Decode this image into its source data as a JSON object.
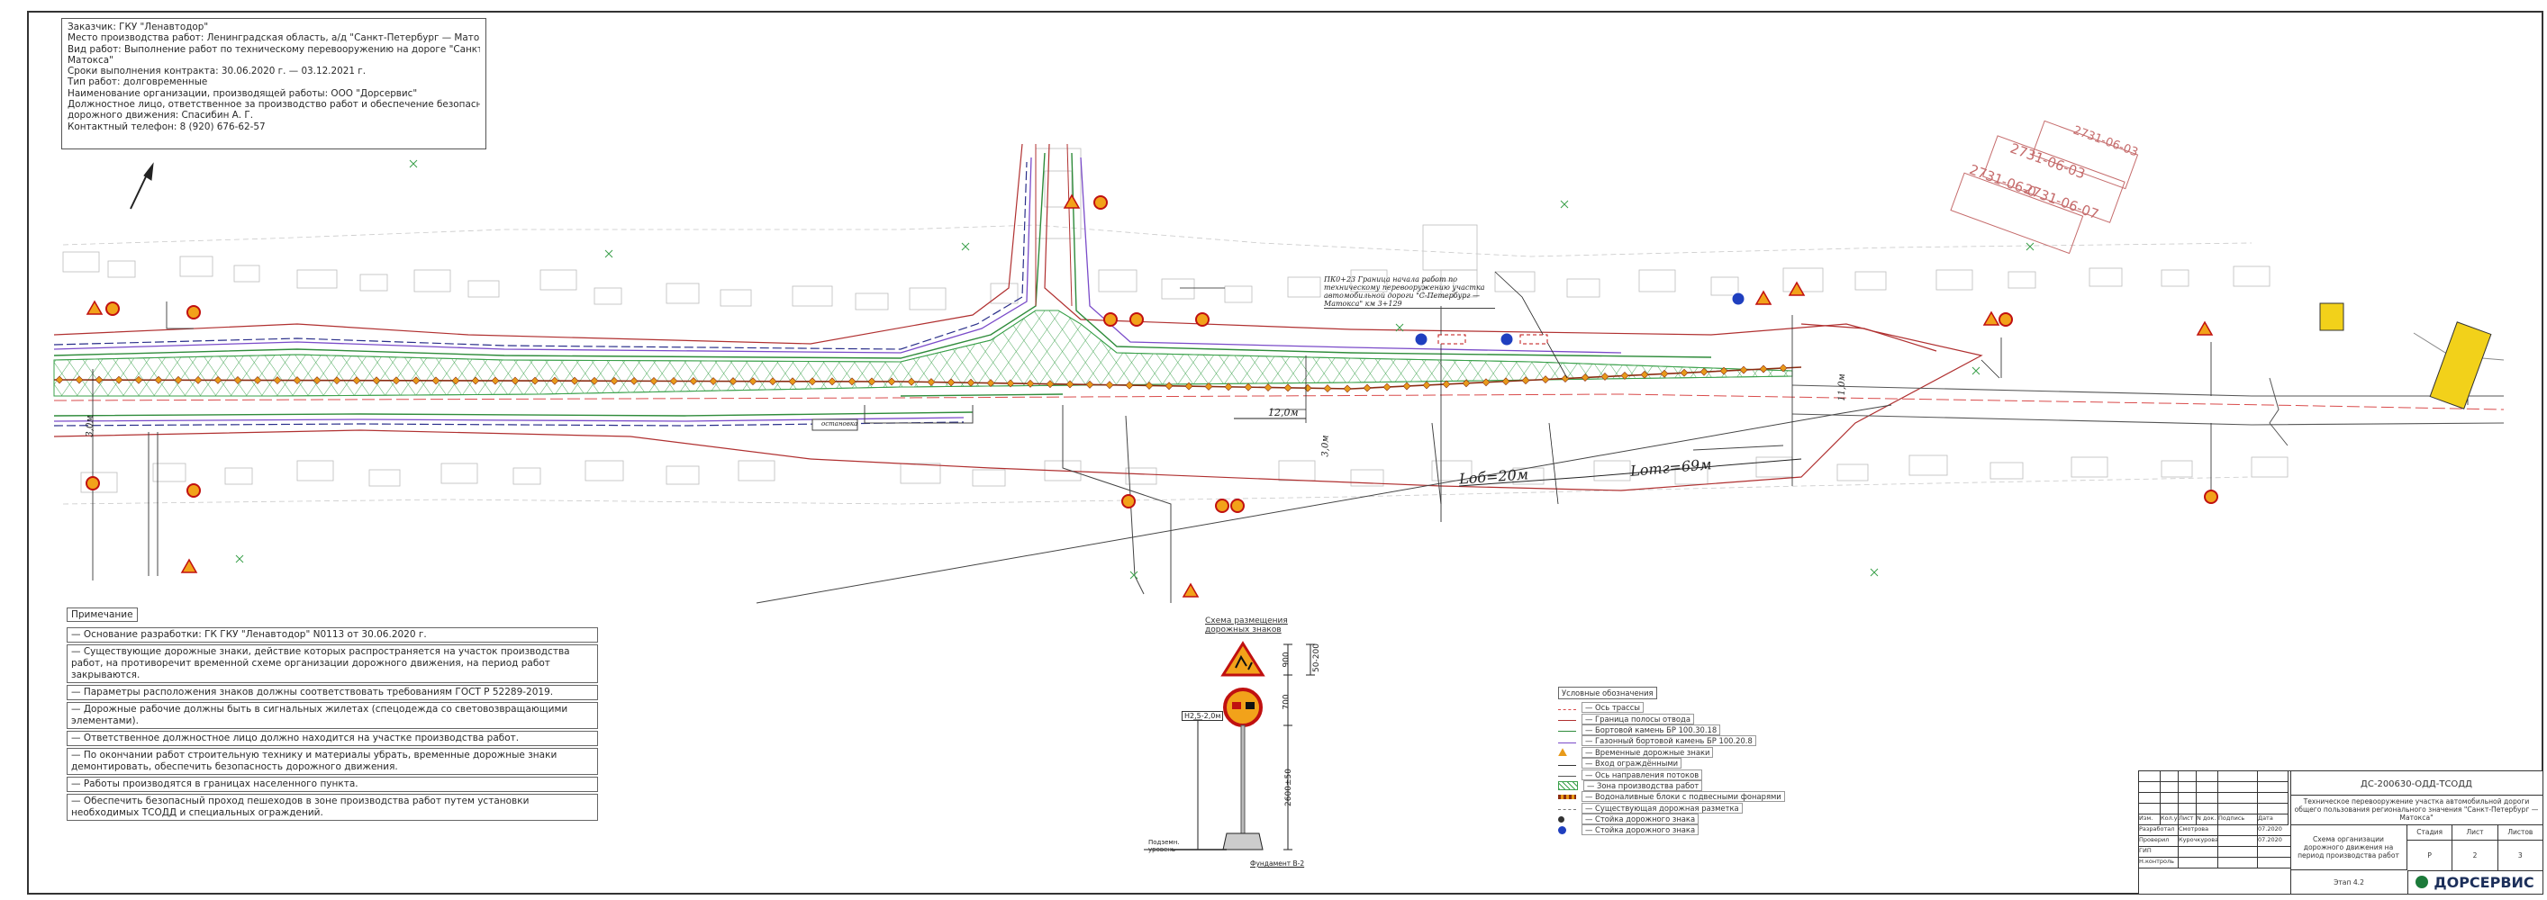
{
  "info": {
    "lines": [
      "Заказчик: ГКУ \"Ленавтодор\"",
      "Место производства работ: Ленинградская область, а/д \"Санкт-Петербург — Матокса\"",
      "Вид работ: Выполнение работ по техническому перевооружению на дороге \"Санкт-Петербург —",
      "Матокса\"",
      "Сроки выполнения контракта: 30.06.2020 г. — 03.12.2021 г.",
      "Тип работ: долговременные",
      "Наименование организации, производящей работы: ООО \"Дорсервис\"",
      "Должностное лицо, ответственное за производство работ и обеспечение безопасности",
      "дорожного движения: Спасибин А. Г.",
      "Контактный телефон: 8 (920) 676-62-57"
    ]
  },
  "notes": {
    "heading": "Примечание",
    "items": [
      "— Основание разработки: ГК ГКУ \"Ленавтодор\" N0113 от 30.06.2020 г.",
      "— Существующие дорожные знаки, действие которых распространяется на участок производства работ, на противоречит временной схеме организации дорожного движения, на период работ закрываются.",
      "— Параметры расположения знаков должны соответствовать требованиям ГОСТ Р 52289-2019.",
      "— Дорожные рабочие должны быть в сигнальных жилетах (спецодежда со световозвращающими элементами).",
      "— Ответственное должностное лицо должно находится на участке производства работ.",
      "— По окончании работ строительную технику и материалы убрать, временные дорожные знаки демонтировать, обеспечить безопасность дорожного движения.",
      "— Работы производятся в границах населенного пункта.",
      "— Обеспечить безопасный проход пешеходов в зоне производства работ путем установки необходимых ТСОДД и специальных ограждений."
    ]
  },
  "scheme": {
    "title_1": "Схема размещения",
    "title_2": "дорожных знаков",
    "dim_900": "900",
    "dim_50_200": "50-200",
    "dim_700": "700",
    "dim_2600": "2600±50",
    "label_height": "H2,5-2,0м",
    "label_ground": "Подземн. уровень",
    "label_foundation": "Фундамент В-2"
  },
  "legend": {
    "title": "Условные обозначения",
    "items": [
      {
        "label": "— Ось трассы",
        "color": "#d94b4b",
        "style": "dash"
      },
      {
        "label": "— Граница полосы отвода",
        "color": "#b03030",
        "style": "solid"
      },
      {
        "label": "— Бортовой камень БР 100.30.18",
        "color": "#2e8b3a",
        "style": "solid"
      },
      {
        "label": "— Газонный бортовой камень БР 100.20.8",
        "color": "#7a4bc9",
        "style": "solid"
      },
      {
        "label": "— Временные дорожные знаки",
        "color": "#e89a1a",
        "style": "sign"
      },
      {
        "label": "— Вход ограждёнными",
        "color": "#333333",
        "style": "solid"
      },
      {
        "label": "— Ось направления потоков",
        "color": "#555555",
        "style": "arrow"
      },
      {
        "label": "— Зона производства работ",
        "color": "#3aa04a",
        "style": "hatch"
      },
      {
        "label": "— Водоналивные блоки с подвесными фонарями",
        "color": "#8b2c12",
        "style": "blocks"
      },
      {
        "label": "— Существующая дорожная разметка",
        "color": "#777777",
        "style": "dash"
      },
      {
        "label": "— Стойка дорожного знака",
        "color": "#333333",
        "style": "dot"
      },
      {
        "label": "— Стойка дорожного знака",
        "color": "#1f3fbf",
        "style": "bluedot"
      }
    ]
  },
  "stamp": {
    "doc_number": "ДС-200630-ОДД-ТСОДД",
    "project": "Техническое перевооружение участка автомобильной дороги общего пользования регионального значения \"Санкт-Петербург — Матокса\"",
    "sheet_title": "Схема организации дорожного движения на период производства работ",
    "stage_h": "Стадия",
    "sheet_h": "Лист",
    "sheets_h": "Листов",
    "stage": "Р",
    "sheet": "2",
    "sheets": "3",
    "phase": "Этап 4.2",
    "company": "ДОРСЕРВИС",
    "roles": [
      "Изм.",
      "Кол.уч",
      "Лист",
      "N док.",
      "Подпись",
      "Дата"
    ],
    "people": [
      {
        "role": "Разработал",
        "name": "Смотрова",
        "date": "07.2020"
      },
      {
        "role": "Проверил",
        "name": "Курочкурова",
        "date": "07.2020"
      },
      {
        "role": "ГИП",
        "name": "",
        "date": ""
      },
      {
        "role": "Н.контроль",
        "name": "",
        "date": ""
      }
    ]
  },
  "annotations": {
    "stamp_a": "2731-06-03",
    "stamp_b": "2731-06-07",
    "stamp_c": "2731-06-0",
    "stamp_d": "2731-06-03",
    "road_note": "ПК0+23 Граница начала работ по техническому перевооружению участка автомобильной дороги \"С-Петербург — Матокса\" км 3+129",
    "l_ob": "Lоб=20м",
    "l_otgon": "Lотг=69м",
    "dim_12m": "12,0м",
    "dim_11m": "11,0м",
    "dim_3m": "3,0м",
    "dim_3m_b": "3,0м",
    "bus_stop": "остановка"
  }
}
